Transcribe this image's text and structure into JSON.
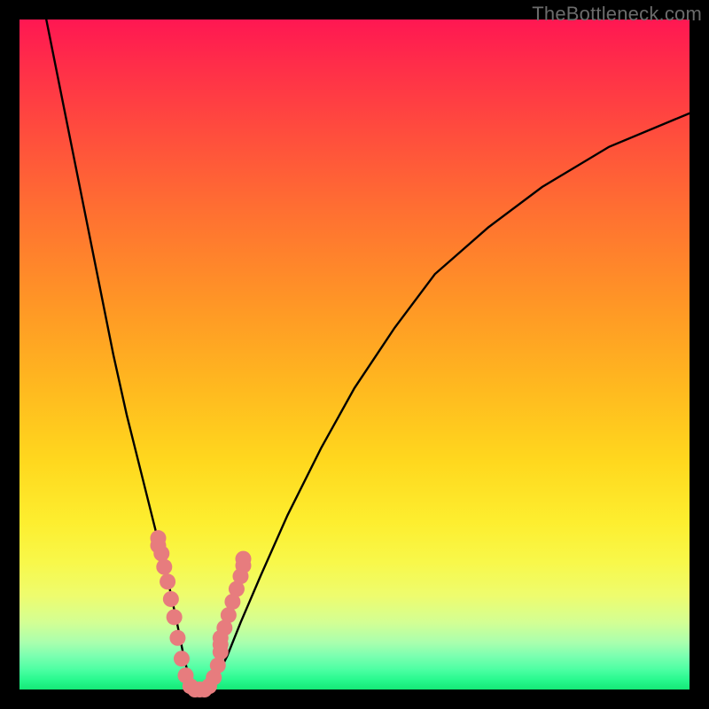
{
  "watermark": "TheBottleneck.com",
  "colors": {
    "background": "#000000",
    "gradient_top": "#ff1752",
    "gradient_mid": "#ffd81e",
    "gradient_bottom": "#15e877",
    "curve": "#000000",
    "marker": "#e77c7e"
  },
  "chart_data": {
    "type": "line",
    "title": "",
    "xlabel": "",
    "ylabel": "",
    "xlim": [
      0,
      100
    ],
    "ylim": [
      0,
      100
    ],
    "series": [
      {
        "name": "bottleneck-curve",
        "x": [
          4,
          6,
          8,
          10,
          12,
          14,
          16,
          18,
          20,
          22,
          23.5,
          24.5,
          25.5,
          27,
          29,
          31,
          33,
          36,
          40,
          45,
          50,
          56,
          62,
          70,
          78,
          88,
          100
        ],
        "y": [
          100,
          90,
          80,
          70,
          60,
          50,
          41,
          33,
          25,
          17,
          10,
          5,
          1,
          0,
          1,
          5,
          10,
          17,
          26,
          36,
          45,
          54,
          62,
          69,
          75,
          81,
          86
        ]
      }
    ],
    "markers": {
      "name": "highlight-dots",
      "x": [
        20.7,
        20.7,
        21.2,
        21.6,
        22.1,
        22.6,
        23.1,
        23.6,
        24.2,
        24.8,
        25.5,
        26.2,
        26.9,
        27.6,
        28.3,
        29.0,
        29.6,
        30.0,
        30.0,
        30.0,
        30.6,
        31.2,
        31.8,
        32.4,
        33.0,
        33.4,
        33.4
      ],
      "y": [
        22.6,
        21.5,
        20.3,
        18.3,
        16.1,
        13.5,
        10.8,
        7.7,
        4.6,
        2.1,
        0.5,
        0.0,
        0.0,
        0.0,
        0.5,
        1.8,
        3.6,
        5.6,
        6.7,
        7.7,
        9.2,
        11.1,
        13.1,
        15.0,
        16.9,
        18.5,
        19.5
      ]
    }
  }
}
